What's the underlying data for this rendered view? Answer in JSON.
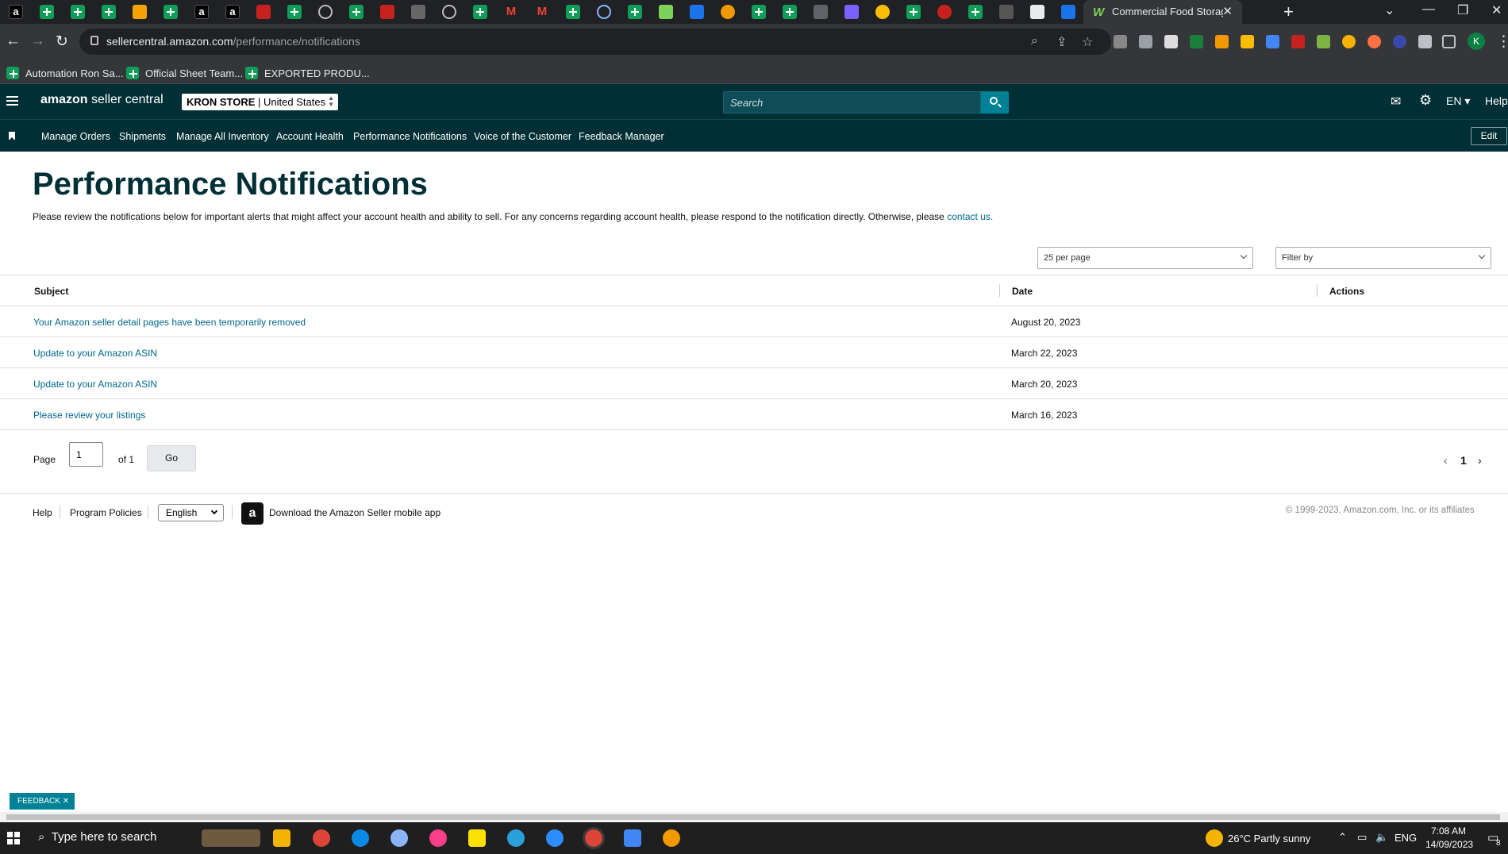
{
  "browser": {
    "active_tab_title": "Commercial Food Storage Conta",
    "url_host": "sellercentral.amazon.com",
    "url_path": "/performance/notifications",
    "bookmarks": [
      "Automation Ron Sa...",
      "Official Sheet Team...",
      "EXPORTED PRODU..."
    ]
  },
  "header": {
    "logo_brand": "amazon",
    "logo_suffix": " seller central",
    "store_name": "KRON STORE",
    "store_region": " | United States",
    "search_placeholder": "Search",
    "language": "EN",
    "help": "Help"
  },
  "nav": {
    "items": [
      "Manage Orders",
      "Shipments",
      "Manage All Inventory",
      "Account Health",
      "Performance Notifications",
      "Voice of the Customer",
      "Feedback Manager"
    ],
    "edit": "Edit"
  },
  "page": {
    "title": "Performance Notifications",
    "intro_text": "Please review the notifications below for important alerts that might affect your account health and ability to sell. For any concerns regarding account health, please respond to the notification directly. Otherwise, please ",
    "intro_link": "contact us."
  },
  "controls": {
    "per_page": "25 per page",
    "filter_placeholder": "Filter by"
  },
  "table": {
    "columns": [
      "Subject",
      "Date",
      "Actions"
    ],
    "rows": [
      {
        "subject": "Your Amazon seller detail pages have been temporarily removed",
        "date": "August 20, 2023"
      },
      {
        "subject": "Update to your Amazon ASIN",
        "date": "March 22, 2023"
      },
      {
        "subject": "Update to your Amazon ASIN",
        "date": "March 20, 2023"
      },
      {
        "subject": "Please review your listings",
        "date": "March 16, 2023"
      }
    ]
  },
  "pagination": {
    "page_label": "Page",
    "page_value": "1",
    "of_label": "of 1",
    "go": "Go",
    "current": "1"
  },
  "footer": {
    "help": "Help",
    "policies": "Program Policies",
    "language": "English",
    "app_text": "Download the Amazon Seller mobile app",
    "copyright": "© 1999-2023, Amazon.com, Inc. or its affiliates"
  },
  "feedback": "FEEDBACK",
  "taskbar": {
    "search_placeholder": "Type here to search",
    "weather": "26°C  Partly sunny",
    "lang": "ENG",
    "time": "7:08 AM",
    "date": "14/09/2023",
    "notif_count": "8"
  },
  "colors": {
    "header_bg": "#002f36",
    "link": "#00688f",
    "accent": "#008296"
  }
}
